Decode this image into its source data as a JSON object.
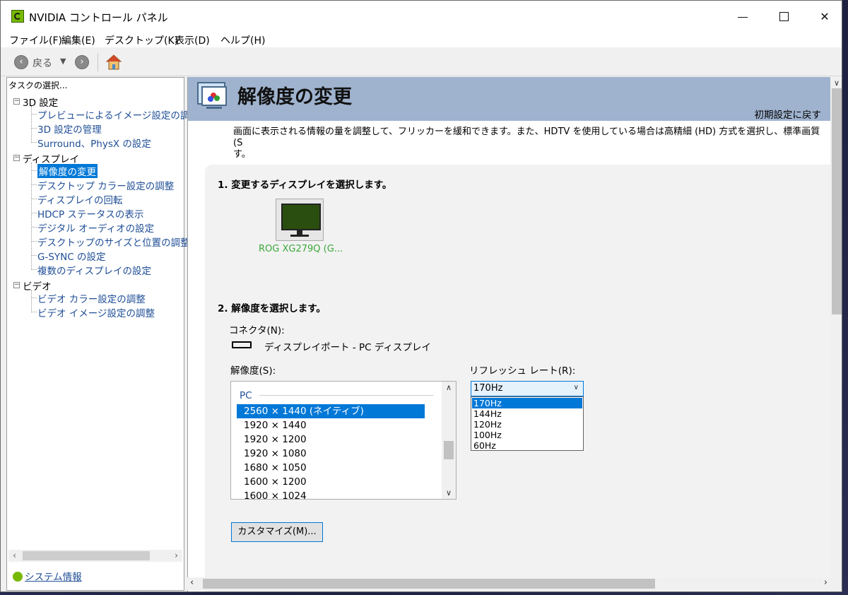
{
  "window": {
    "title": "NVIDIA コントロール パネル"
  },
  "menu": [
    "ファイル(F)",
    "編集(E)",
    "デスクトップ(K)",
    "表示(D)",
    "ヘルプ(H)"
  ],
  "toolbar": {
    "back_label": "戻る"
  },
  "left_panel": {
    "task_label": "タスクの選択...",
    "groups": [
      {
        "label": "3D 設定",
        "items": [
          "プレビューによるイメージ設定の調整",
          "3D 設定の管理",
          "Surround、PhysX の設定"
        ]
      },
      {
        "label": "ディスプレイ",
        "items": [
          "解像度の変更",
          "デスクトップ カラー設定の調整",
          "ディスプレイの回転",
          "HDCP ステータスの表示",
          "デジタル オーディオの設定",
          "デスクトップのサイズと位置の調整",
          "G-SYNC の設定",
          "複数のディスプレイの設定"
        ]
      },
      {
        "label": "ビデオ",
        "items": [
          "ビデオ カラー設定の調整",
          "ビデオ イメージ設定の調整"
        ]
      }
    ],
    "selected_item": "解像度の変更",
    "system_info_link": "システム情報"
  },
  "main": {
    "title": "解像度の変更",
    "restore_defaults": "初期設定に戻す",
    "description": "画面に表示される情報の量を調整して、フリッカーを緩和できます。また、HDTV を使用している場合は高精細 (HD) 方式を選択し、標準画質 (S",
    "description_line2": "す。",
    "section1": "1. 変更するディスプレイを選択します。",
    "display_name": "ROG XG279Q (G...",
    "section2": "2. 解像度を選択します。",
    "connector_label": "コネクタ(N):",
    "connector_value": "ディスプレイポート - PC ディスプレイ",
    "resolution_label": "解像度(S):",
    "refresh_label": "リフレッシュ レート(R):",
    "resolution_group": "PC",
    "resolutions": [
      "2560 × 1440 (ネイティブ)",
      "1920 × 1440",
      "1920 × 1200",
      "1920 × 1080",
      "1680 × 1050",
      "1600 × 1200",
      "1600 × 1024"
    ],
    "selected_resolution": "2560 × 1440 (ネイティブ)",
    "refresh_value": "170Hz",
    "refresh_options": [
      "170Hz",
      "144Hz",
      "120Hz",
      "100Hz",
      "60Hz"
    ],
    "customize_button": "カスタマイズ(M)..."
  }
}
